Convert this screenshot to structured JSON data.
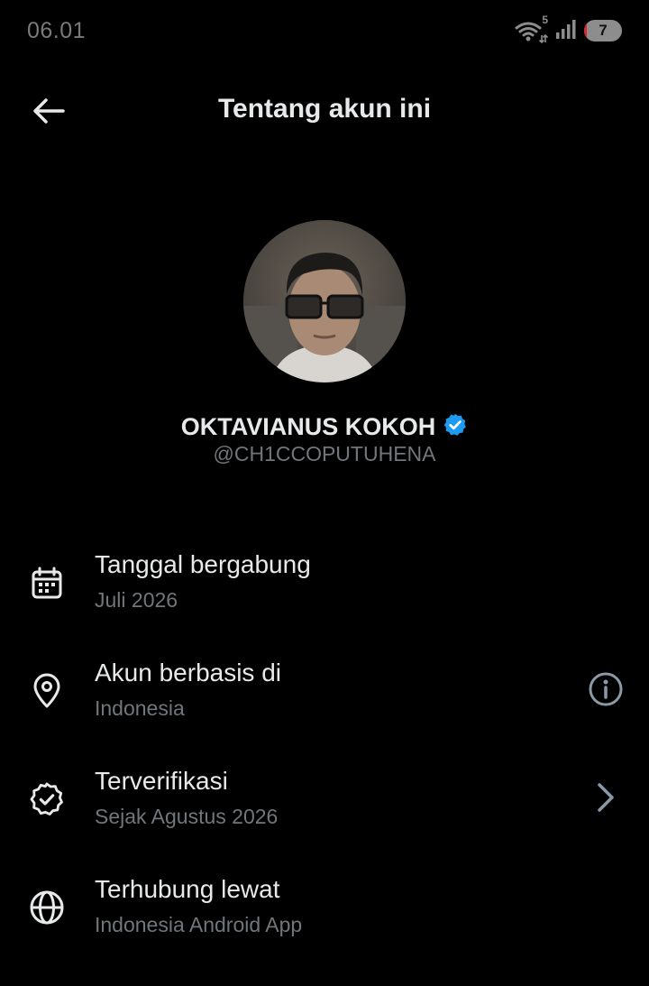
{
  "status_bar": {
    "time": "06.01",
    "wifi_badge": "5",
    "battery_level": "7"
  },
  "header": {
    "title": "Tentang akun ini"
  },
  "profile": {
    "name": "OKTAVIANUS KOKOH",
    "handle": "@CH1CCOPUTUHENA",
    "verified_color": "#1d9bf0"
  },
  "info": {
    "joined": {
      "title": "Tanggal bergabung",
      "value": "Juli 2026",
      "icon": "calendar-icon"
    },
    "based_in": {
      "title": "Akun berbasis di",
      "value": "Indonesia",
      "icon": "location-pin-icon",
      "action_icon": "info-icon"
    },
    "verified": {
      "title": "Terverifikasi",
      "value": "Sejak Agustus 2026",
      "icon": "verified-badge-icon",
      "action_icon": "chevron-right-icon"
    },
    "connected": {
      "title": "Terhubung lewat",
      "value": "Indonesia Android App",
      "icon": "globe-icon"
    }
  },
  "colors": {
    "background": "#000000",
    "primary_text": "#e7e9ea",
    "secondary_text": "#71767b",
    "accent": "#1d9bf0"
  }
}
